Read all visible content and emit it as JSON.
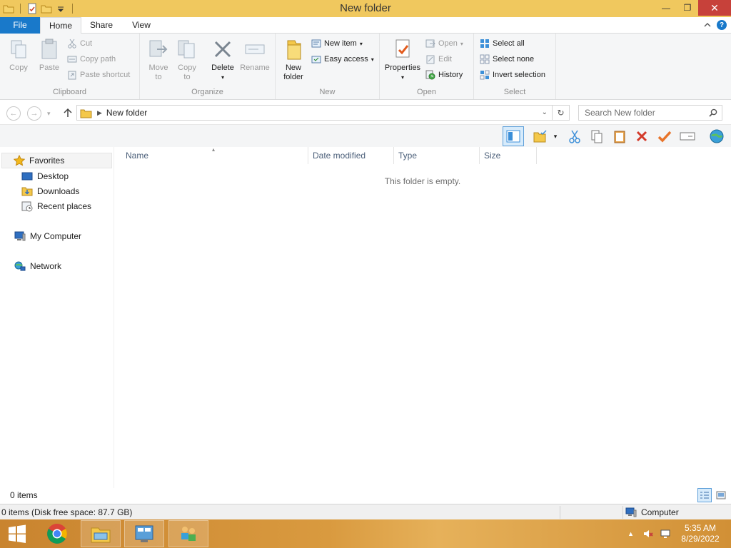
{
  "window": {
    "title": "New folder",
    "controls": {
      "minimize": "—",
      "restore": "❐",
      "close": "✕"
    }
  },
  "ribbon": {
    "tabs": {
      "file": "File",
      "home": "Home",
      "share": "Share",
      "view": "View"
    },
    "clipboard": {
      "label": "Clipboard",
      "copy": "Copy",
      "paste": "Paste",
      "cut": "Cut",
      "copy_path": "Copy path",
      "paste_shortcut": "Paste shortcut"
    },
    "organize": {
      "label": "Organize",
      "move_to": [
        "Move",
        "to"
      ],
      "copy_to": [
        "Copy",
        "to"
      ],
      "delete": "Delete",
      "rename": "Rename"
    },
    "new": {
      "label": "New",
      "new_folder": [
        "New",
        "folder"
      ],
      "new_item": "New item",
      "easy_access": "Easy access"
    },
    "open": {
      "label": "Open",
      "properties": "Properties",
      "open": "Open",
      "edit": "Edit",
      "history": "History"
    },
    "select": {
      "label": "Select",
      "select_all": "Select all",
      "select_none": "Select none",
      "invert_selection": "Invert selection"
    }
  },
  "address": {
    "path": "New folder",
    "search_placeholder": "Search New folder"
  },
  "navpane": {
    "favorites": "Favorites",
    "desktop": "Desktop",
    "downloads": "Downloads",
    "recent_places": "Recent places",
    "my_computer": "My Computer",
    "network": "Network"
  },
  "content": {
    "columns": {
      "name": "Name",
      "date_modified": "Date modified",
      "type": "Type",
      "size": "Size"
    },
    "empty_message": "This folder is empty."
  },
  "status": {
    "items": "0 items",
    "disk_info": "0 items (Disk free space: 87.7 GB)",
    "location": "Computer"
  },
  "taskbar": {
    "time": "5:35 AM",
    "date": "8/29/2022"
  },
  "colors": {
    "title_bar": "#f0c85e",
    "file_tab": "#1979ca",
    "close_button": "#c7413a",
    "taskbar": "#d99a3f"
  }
}
